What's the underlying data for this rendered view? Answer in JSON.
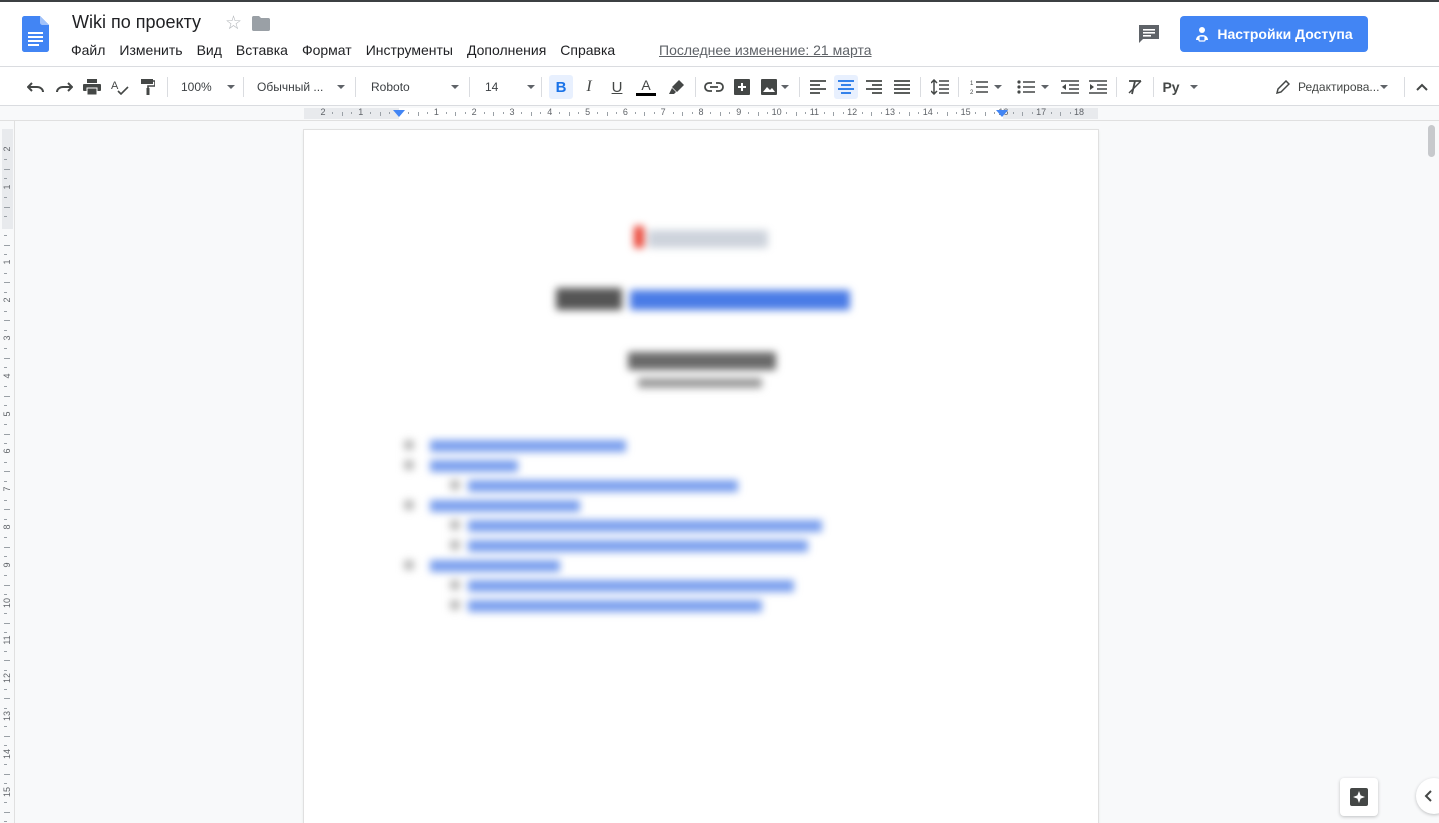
{
  "document": {
    "title": "Wiki по проекту",
    "last_edit": "Последнее изменение: 21 марта"
  },
  "menu": {
    "items": [
      "Файл",
      "Изменить",
      "Вид",
      "Вставка",
      "Формат",
      "Инструменты",
      "Дополнения",
      "Справка"
    ]
  },
  "share": {
    "label": "Настройки Доступа"
  },
  "toolbar": {
    "zoom": "100%",
    "style": "Обычный ...",
    "font": "Roboto",
    "font_size": "14",
    "input_tools": "Ру",
    "mode": "Редактирова..."
  },
  "ruler": {
    "numbers": [
      "2",
      "1",
      "",
      "1",
      "2",
      "3",
      "4",
      "5",
      "6",
      "7",
      "8",
      "9",
      "10",
      "11",
      "12",
      "13",
      "14",
      "15",
      "16",
      "17",
      "18"
    ]
  },
  "vruler": {
    "numbers": [
      "2",
      "1",
      "",
      "1",
      "2",
      "3",
      "4",
      "5",
      "6",
      "7",
      "8",
      "9",
      "10",
      "11",
      "12",
      "13",
      "14",
      "15"
    ]
  },
  "colors": {
    "accent": "#4285f4",
    "doc_icon": "#4285f4",
    "text_color_bar": "#000000"
  }
}
